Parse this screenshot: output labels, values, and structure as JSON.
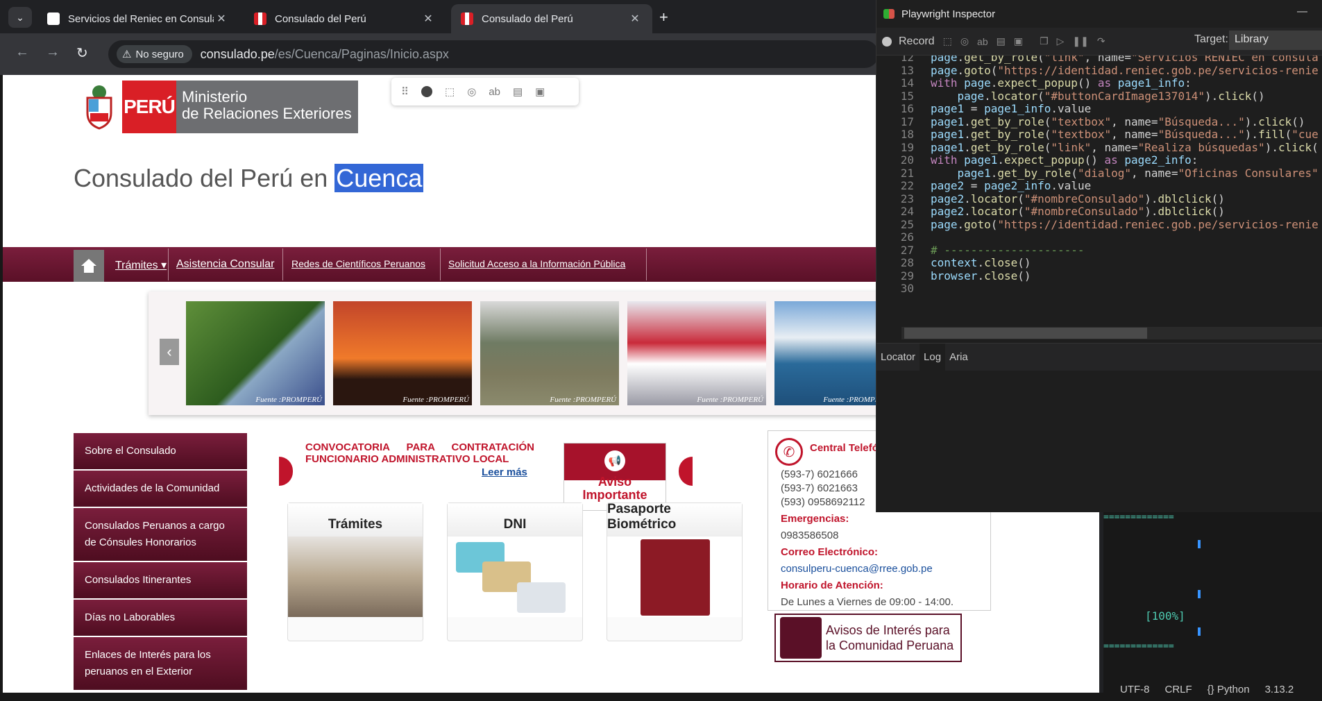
{
  "tabs": [
    {
      "title": "Servicios del Reniec en Consulad",
      "active": false
    },
    {
      "title": "Consulado del Perú",
      "active": false
    },
    {
      "title": "Consulado del Perú",
      "active": true
    }
  ],
  "address_bar": {
    "security": "No seguro",
    "host": "consulado.pe",
    "path": "/es/Cuenca/Paginas/Inicio.aspx"
  },
  "site": {
    "logo_brand": "PERÚ",
    "logo_ministry_line1": "Ministerio",
    "logo_ministry_line2": "de Relaciones Exteriores",
    "title_prefix": "Consulado del Perú en ",
    "title_highlight": "Cuenca",
    "nav": [
      "Trámites",
      "Asistencia Consular",
      "Redes de Científicos Peruanos",
      "Solicitud Acceso a la Información Pública"
    ],
    "photo_caption": "Fuente :PROMPERÚ",
    "side_menu": [
      "Sobre el Consulado",
      "Actividades de la Comunidad",
      "Consulados Peruanos a cargo de Cónsules Honorarios",
      "Consulados Itinerantes",
      "Días no Laborables",
      "Enlaces de Interés para los peruanos en el Exterior"
    ],
    "announcement": "CONVOCATORIA PARA CONTRATACIÓN FUNCIONARIO ADMINISTRATIVO LOCAL",
    "read_more": "Leer más",
    "aviso_line1": "Aviso",
    "aviso_line2": "Importante",
    "cards": [
      "Trámites",
      "DNI",
      "Pasaporte Biométrico"
    ],
    "contact": {
      "header": "Central Telefó",
      "phones": [
        "(593-7) 6021666",
        "(593-7) 6021663",
        "(593) 0958692112"
      ],
      "emergency_label": "Emergencias:",
      "emergency": "0983586508",
      "email_label": "Correo Electrónico:",
      "email": "consulperu-cuenca@rree.gob.pe",
      "hours_label": "Horario de Atención:",
      "hours": "De Lunes a Viernes de 09:00 - 14:00."
    },
    "avisos_line1": "Avisos de Interés para",
    "avisos_line2": "la Comunidad Peruana",
    "colors": {
      "brand": "#d91f26",
      "nav": "#6a1731",
      "accent": "#c0142b"
    }
  },
  "inspector": {
    "title": "Playwright Inspector",
    "record": "Record",
    "target_label": "Target:",
    "target_value": "Library",
    "tabs": [
      "Locator",
      "Log",
      "Aria"
    ],
    "code_lines": [
      {
        "n": "12",
        "text": "page.get_by_role(\"link\", name=\"Servicios RENIEC en consula"
      },
      {
        "n": "13",
        "text": "page.goto(\"https://identidad.reniec.gob.pe/servicios-renie"
      },
      {
        "n": "14",
        "text": "with page.expect_popup() as page1_info:"
      },
      {
        "n": "15",
        "text": "    page.locator(\"#buttonCardImage137014\").click()"
      },
      {
        "n": "16",
        "text": "page1 = page1_info.value"
      },
      {
        "n": "17",
        "text": "page1.get_by_role(\"textbox\", name=\"Búsqueda...\").click()"
      },
      {
        "n": "18",
        "text": "page1.get_by_role(\"textbox\", name=\"Búsqueda...\").fill(\"cue"
      },
      {
        "n": "19",
        "text": "page1.get_by_role(\"link\", name=\"Realiza búsquedas\").click("
      },
      {
        "n": "20",
        "text": "with page1.expect_popup() as page2_info:"
      },
      {
        "n": "21",
        "text": "    page1.get_by_role(\"dialog\", name=\"Oficinas Consulares\""
      },
      {
        "n": "22",
        "text": "page2 = page2_info.value"
      },
      {
        "n": "23",
        "text": "page2.locator(\"#nombreConsulado\").dblclick()"
      },
      {
        "n": "24",
        "text": "page2.locator(\"#nombreConsulado\").dblclick()"
      },
      {
        "n": "25",
        "text": "page.goto(\"https://identidad.reniec.gob.pe/servicios-renie"
      },
      {
        "n": "26",
        "text": ""
      },
      {
        "n": "27",
        "text": "# ---------------------"
      },
      {
        "n": "28",
        "text": "context.close()"
      },
      {
        "n": "29",
        "text": "browser.close()"
      },
      {
        "n": "30",
        "text": ""
      }
    ]
  },
  "vscode": {
    "progress_text": "[100%]",
    "status": [
      "UTF-8",
      "CRLF",
      "{} Python",
      "3.13.2"
    ]
  }
}
